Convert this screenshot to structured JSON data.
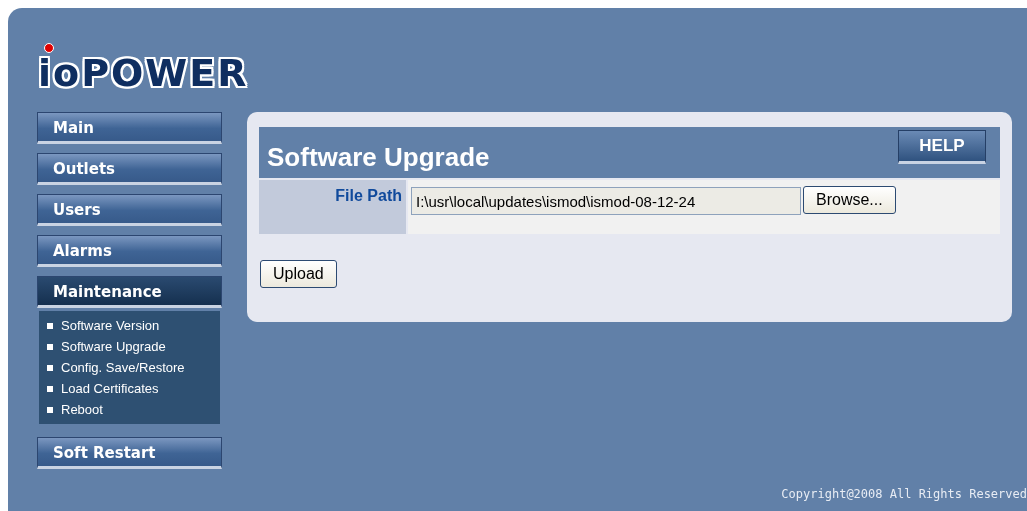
{
  "logo": {
    "text": "ioPOWER"
  },
  "nav": [
    {
      "label": "Main",
      "selected": false
    },
    {
      "label": "Outlets",
      "selected": false
    },
    {
      "label": "Users",
      "selected": false
    },
    {
      "label": "Alarms",
      "selected": false
    },
    {
      "label": "Maintenance",
      "selected": true,
      "children": [
        {
          "label": "Software Version"
        },
        {
          "label": "Software Upgrade"
        },
        {
          "label": "Config. Save/Restore"
        },
        {
          "label": "Load Certificates"
        },
        {
          "label": "Reboot"
        }
      ]
    },
    {
      "label": "Soft Restart",
      "selected": false
    }
  ],
  "panel": {
    "title": "Software Upgrade",
    "help_button": "HELP",
    "field_label": "File Path",
    "file_path": "I:\\usr\\local\\updates\\ismod\\ismod-08-12-24",
    "browse_button": "Browse...",
    "upload_button": "Upload"
  },
  "footer": {
    "copyright": "Copyright@2008 All Rights Reserved"
  }
}
